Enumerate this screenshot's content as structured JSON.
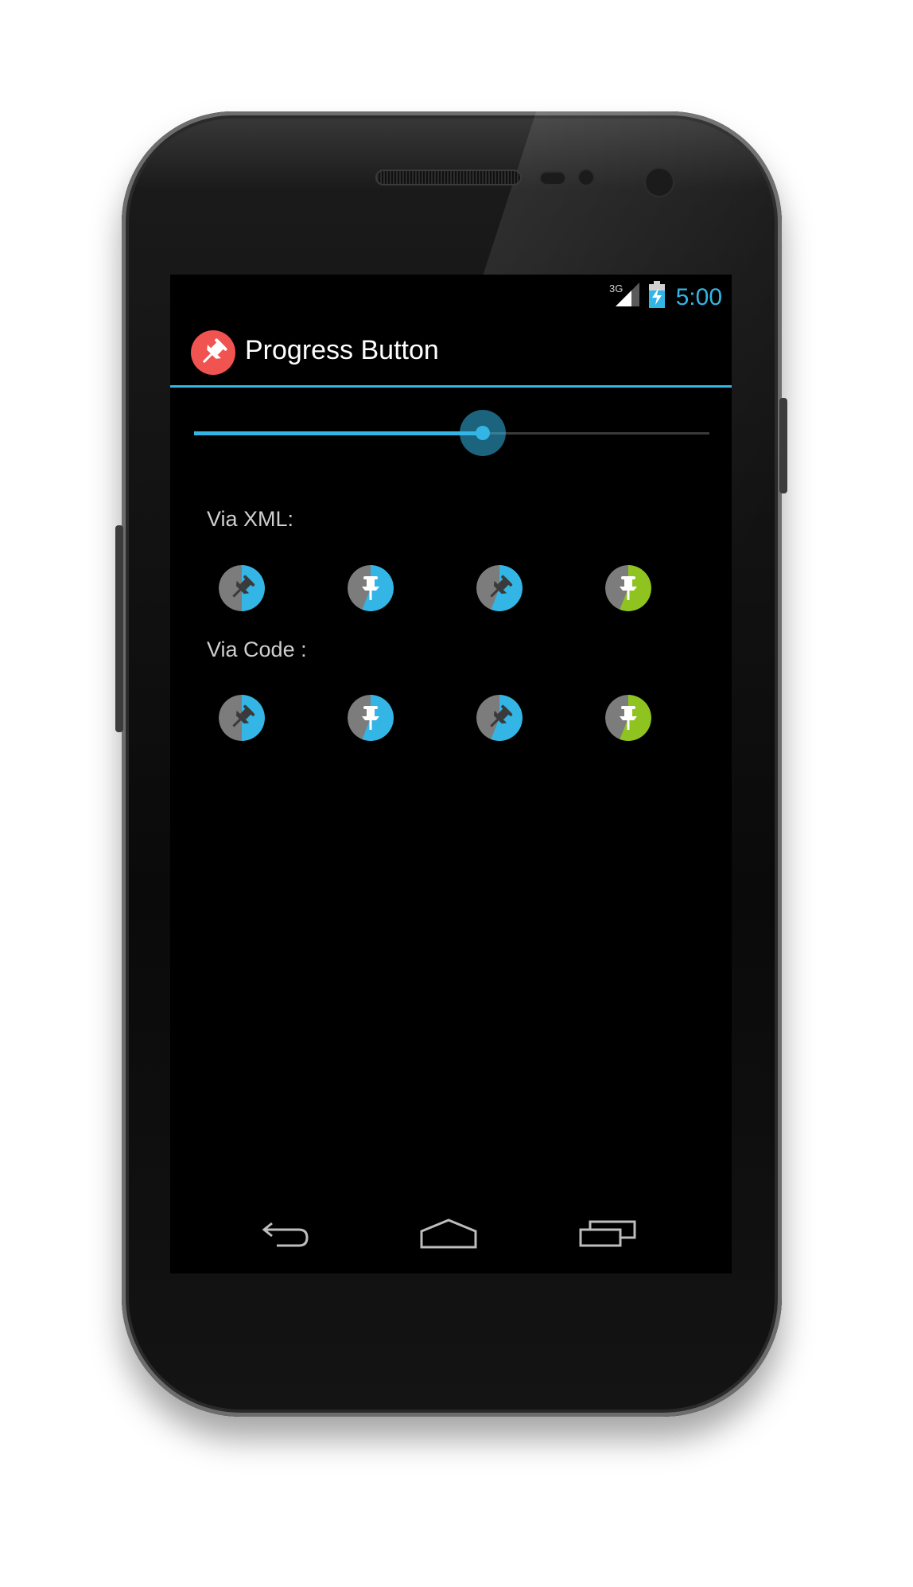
{
  "status_bar": {
    "network_label": "3G",
    "time": "5:00",
    "icons": [
      "network-3g-icon",
      "signal-icon",
      "battery-charging-icon"
    ]
  },
  "action_bar": {
    "title": "Progress Button",
    "icon": "pin-icon",
    "accent_color": "#33b5e5",
    "icon_color": "#f05350"
  },
  "slider": {
    "progress": 0.56
  },
  "sections": [
    {
      "label": "Via XML:",
      "buttons": [
        {
          "icon": "pin-icon",
          "state": "in-progress",
          "progress": 0.5,
          "color": "#33b5e5"
        },
        {
          "icon": "pin-icon",
          "state": "pinned",
          "progress": 0.56,
          "color": "#33b5e5"
        },
        {
          "icon": "pin-icon",
          "state": "in-progress",
          "progress": 0.56,
          "color": "#33b5e5"
        },
        {
          "icon": "pin-icon",
          "state": "pinned",
          "progress": 0.56,
          "color": "#8fc31f"
        }
      ]
    },
    {
      "label": "Via Code :",
      "buttons": [
        {
          "icon": "pin-icon",
          "state": "in-progress",
          "progress": 0.5,
          "color": "#33b5e5"
        },
        {
          "icon": "pin-icon",
          "state": "pinned",
          "progress": 0.56,
          "color": "#33b5e5"
        },
        {
          "icon": "pin-icon",
          "state": "in-progress",
          "progress": 0.56,
          "color": "#33b5e5"
        },
        {
          "icon": "pin-icon",
          "state": "pinned",
          "progress": 0.56,
          "color": "#8fc31f"
        }
      ]
    }
  ],
  "nav_bar": {
    "buttons": [
      "back-icon",
      "home-icon",
      "recent-apps-icon"
    ]
  }
}
